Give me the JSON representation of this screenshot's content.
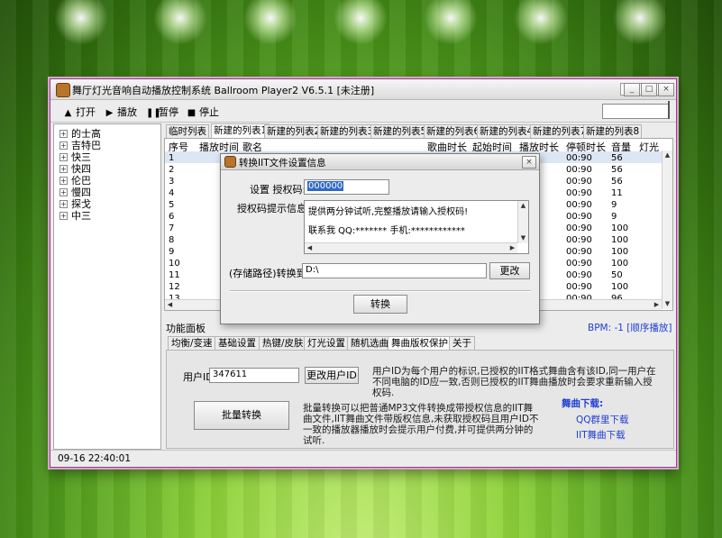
{
  "window": {
    "title": "舞厅灯光音响自动播放控制系统 Ballroom Player2 V6.5.1 [未注册]",
    "controls": {
      "minimize": "_",
      "maximize": "□",
      "close": "×"
    }
  },
  "toolbar": {
    "buttons": [
      {
        "icon": "▲",
        "label": "打开"
      },
      {
        "icon": "▶",
        "label": "播放"
      },
      {
        "icon": "❚❚",
        "label": "暂停"
      },
      {
        "icon": "■",
        "label": "停止"
      }
    ]
  },
  "tree": {
    "items": [
      "的士高",
      "吉特巴",
      "快三",
      "快四",
      "伦巴",
      "慢四",
      "探戈",
      "中三"
    ],
    "expander": "+"
  },
  "playlist_tabs": [
    "临时列表",
    "新建的列表1",
    "新建的列表2",
    "新建的列表3",
    "新建的列表5",
    "新建的列表6",
    "新建的列表4",
    "新建的列表7",
    "新建的列表8"
  ],
  "table": {
    "headers": [
      "序号",
      "播放时间",
      "歌名",
      "歌曲时长",
      "起始时间",
      "播放时长",
      "停顿时长",
      "音量",
      "灯光"
    ],
    "rows": [
      {
        "no": "1",
        "pause": "00:90",
        "volume": "56"
      },
      {
        "no": "2",
        "pause": "00:90",
        "volume": "56"
      },
      {
        "no": "3",
        "pause": "00:90",
        "volume": "56"
      },
      {
        "no": "4",
        "pause": "00:90",
        "volume": "11"
      },
      {
        "no": "5",
        "pause": "00:90",
        "volume": "9"
      },
      {
        "no": "6",
        "pause": "00:90",
        "volume": "9"
      },
      {
        "no": "7",
        "pause": "00:90",
        "volume": "100"
      },
      {
        "no": "8",
        "pause": "00:90",
        "volume": "100"
      },
      {
        "no": "9",
        "pause": "00:90",
        "volume": "100"
      },
      {
        "no": "10",
        "pause": "00:90",
        "volume": "100"
      },
      {
        "no": "11",
        "pause": "00:90",
        "volume": "50"
      },
      {
        "no": "12",
        "pause": "00:90",
        "volume": "100"
      },
      {
        "no": "13",
        "pause": "00:90",
        "volume": "96"
      }
    ]
  },
  "func_panel": {
    "label": "功能面板",
    "bpm": "BPM: -1",
    "play_mode": "[顺序播放]",
    "tabs": [
      "均衡/变速",
      "基础设置",
      "热键/皮肤",
      "灯光设置",
      "随机选曲",
      "舞曲版权保护",
      "关于"
    ],
    "user_id_label": "用户ID:",
    "user_id_value": "347611",
    "change_id_button": "更改用户ID",
    "user_id_desc": "用户ID为每个用户的标识,已授权的IIT格式舞曲含有该ID,同一用户在不同电脑的ID应一致,否则已授权的IIT舞曲播放时会要求重新输入授权码.",
    "batch_button": "批量转换",
    "batch_desc": "批量转换可以把普通MP3文件转换成带授权信息的IIT舞曲文件,IIT舞曲文件带版权信息,未获取授权码且用户ID不一致的播放器播放时会提示用户付费,并可提供两分钟的试听.",
    "download_title": "舞曲下载:",
    "download_links": [
      "QQ群里下载",
      "IIT舞曲下载"
    ]
  },
  "status": {
    "datetime": "09-16 22:40:01"
  },
  "dialog": {
    "title": "转换IIT文件设置信息",
    "auth_code_label": "设置 授权码:",
    "auth_code_value": "000000",
    "hint_label": "授权码提示信息:",
    "hint_line1": "提供两分钟试听,完整播放请输入授权码!",
    "hint_line2": "联系我  QQ:*******  手机:************",
    "path_label": "(存储路径)转换到:",
    "path_value": "D:\\",
    "change_button": "更改",
    "convert_button": "转换",
    "close": "×"
  },
  "colors": {
    "background": "#4f9b1c",
    "window_border": "#9a3a8a",
    "link": "#1f3fd0"
  }
}
